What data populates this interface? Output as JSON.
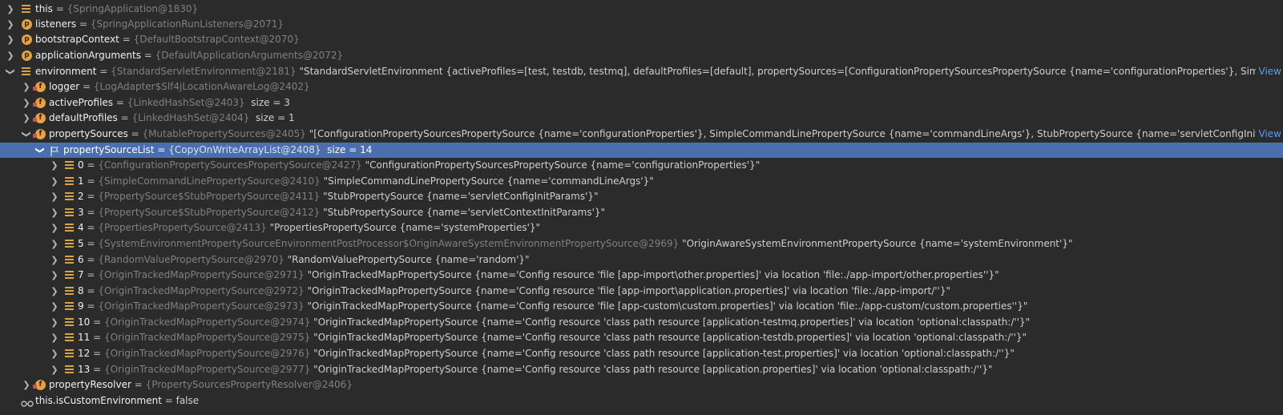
{
  "rows": [
    {
      "id": "this",
      "name": "this",
      "type": "{SpringApplication@1830}"
    },
    {
      "id": "listeners",
      "name": "listeners",
      "type": "{SpringApplicationRunListeners@2071}"
    },
    {
      "id": "bootstrapContext",
      "name": "bootstrapContext",
      "type": "{DefaultBootstrapContext@2070}"
    },
    {
      "id": "applicationArguments",
      "name": "applicationArguments",
      "type": "{DefaultApplicationArguments@2072}"
    },
    {
      "id": "environment",
      "name": "environment",
      "type": "{StandardServletEnvironment@2181}",
      "value": "\"StandardServletEnvironment {activeProfiles=[test, testdb, testmq], defaultProfiles=[default], propertySources=[ConfigurationPropertySourcesPropertySource {name='configurationProperties'}, SimpleCommandI...",
      "view": "View"
    },
    {
      "id": "logger",
      "name": "logger",
      "type": "{LogAdapter$Slf4jLocationAwareLog@2402}"
    },
    {
      "id": "activeProfiles",
      "name": "activeProfiles",
      "type": "{LinkedHashSet@2403}",
      "size": "size = 3"
    },
    {
      "id": "defaultProfiles",
      "name": "defaultProfiles",
      "type": "{LinkedHashSet@2404}",
      "size": "size = 1"
    },
    {
      "id": "propertySources",
      "name": "propertySources",
      "type": "{MutablePropertySources@2405}",
      "value": "\"[ConfigurationPropertySourcesPropertySource {name='configurationProperties'}, SimpleCommandLinePropertySource {name='commandLineArgs'}, StubPropertySource {name='servletConfigInitParams'}, St...",
      "view": "View"
    },
    {
      "id": "propertySourceList",
      "name": "propertySourceList",
      "type": "{CopyOnWriteArrayList@2408}",
      "size": "size = 14"
    },
    {
      "id": "item0",
      "name": "0",
      "type": "{ConfigurationPropertySourcesPropertySource@2427}",
      "value": "\"ConfigurationPropertySourcesPropertySource {name='configurationProperties'}\""
    },
    {
      "id": "item1",
      "name": "1",
      "type": "{SimpleCommandLinePropertySource@2410}",
      "value": "\"SimpleCommandLinePropertySource {name='commandLineArgs'}\""
    },
    {
      "id": "item2",
      "name": "2",
      "type": "{PropertySource$StubPropertySource@2411}",
      "value": "\"StubPropertySource {name='servletConfigInitParams'}\""
    },
    {
      "id": "item3",
      "name": "3",
      "type": "{PropertySource$StubPropertySource@2412}",
      "value": "\"StubPropertySource {name='servletContextInitParams'}\""
    },
    {
      "id": "item4",
      "name": "4",
      "type": "{PropertiesPropertySource@2413}",
      "value": "\"PropertiesPropertySource {name='systemProperties'}\""
    },
    {
      "id": "item5",
      "name": "5",
      "type": "{SystemEnvironmentPropertySourceEnvironmentPostProcessor$OriginAwareSystemEnvironmentPropertySource@2969}",
      "value": "\"OriginAwareSystemEnvironmentPropertySource {name='systemEnvironment'}\""
    },
    {
      "id": "item6",
      "name": "6",
      "type": "{RandomValuePropertySource@2970}",
      "value": "\"RandomValuePropertySource {name='random'}\""
    },
    {
      "id": "item7",
      "name": "7",
      "type": "{OriginTrackedMapPropertySource@2971}",
      "value": "\"OriginTrackedMapPropertySource {name='Config resource 'file [app-import\\other.properties]' via location 'file:./app-import/other.properties''}\""
    },
    {
      "id": "item8",
      "name": "8",
      "type": "{OriginTrackedMapPropertySource@2972}",
      "value": "\"OriginTrackedMapPropertySource {name='Config resource 'file [app-import\\application.properties]' via location 'file:./app-import/''}\""
    },
    {
      "id": "item9",
      "name": "9",
      "type": "{OriginTrackedMapPropertySource@2973}",
      "value": "\"OriginTrackedMapPropertySource {name='Config resource 'file [app-custom\\custom.properties]' via location 'file:./app-custom/custom.properties''}\""
    },
    {
      "id": "item10",
      "name": "10",
      "type": "{OriginTrackedMapPropertySource@2974}",
      "value": "\"OriginTrackedMapPropertySource {name='Config resource 'class path resource [application-testmq.properties]' via location 'optional:classpath:/''}\""
    },
    {
      "id": "item11",
      "name": "11",
      "type": "{OriginTrackedMapPropertySource@2975}",
      "value": "\"OriginTrackedMapPropertySource {name='Config resource 'class path resource [application-testdb.properties]' via location 'optional:classpath:/''}\""
    },
    {
      "id": "item12",
      "name": "12",
      "type": "{OriginTrackedMapPropertySource@2976}",
      "value": "\"OriginTrackedMapPropertySource {name='Config resource 'class path resource [application-test.properties]' via location 'optional:classpath:/''}\""
    },
    {
      "id": "item13",
      "name": "13",
      "type": "{OriginTrackedMapPropertySource@2977}",
      "value": "\"OriginTrackedMapPropertySource {name='Config resource 'class path resource [application.properties]' via location 'optional:classpath:/''}\""
    },
    {
      "id": "propertyResolver",
      "name": "propertyResolver",
      "type": "{PropertySourcesPropertyResolver@2406}"
    },
    {
      "id": "isCustomEnvironment",
      "name": "this.isCustomEnvironment",
      "value": "false"
    }
  ],
  "icons": {
    "stack": "variable-stack-icon",
    "protected": "protected-field-icon",
    "private": "private-field-icon",
    "final": "final-field-icon",
    "flag": "list-field-icon",
    "watch": "watch-glasses-icon"
  },
  "colors": {
    "background": "#2b2b2b",
    "selection": "#4b6eaf",
    "icon_orange": "#e8a33e",
    "link_blue": "#589df6"
  }
}
